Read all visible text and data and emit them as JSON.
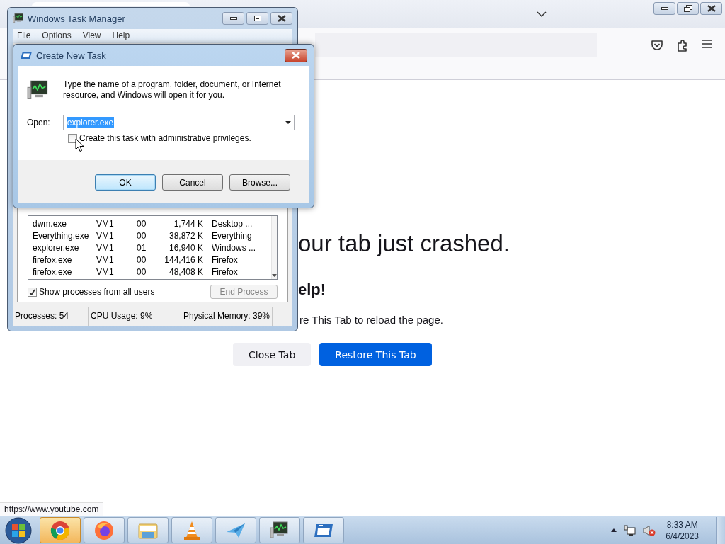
{
  "browser": {
    "status_link": "https://www.youtube.com",
    "crash_page": {
      "heading": "our tab just crashed.",
      "subheading": "elp!",
      "instruction": "re This Tab to reload the page.",
      "buttons": [
        {
          "label": "Close Tab",
          "kind": "secondary"
        },
        {
          "label": "Restore This Tab",
          "kind": "primary"
        }
      ]
    }
  },
  "task_manager": {
    "title": "Windows Task Manager",
    "menu": [
      "File",
      "Options",
      "View",
      "Help"
    ],
    "processes": {
      "rows": [
        [
          "dwm.exe",
          "VM1",
          "00",
          "1,744 K",
          "Desktop ..."
        ],
        [
          "Everything.exe",
          "VM1",
          "00",
          "38,872 K",
          "Everything"
        ],
        [
          "explorer.exe",
          "VM1",
          "01",
          "16,940 K",
          "Windows ..."
        ],
        [
          "firefox.exe",
          "VM1",
          "00",
          "144,416 K",
          "Firefox"
        ],
        [
          "firefox.exe",
          "VM1",
          "00",
          "48,408 K",
          "Firefox"
        ]
      ]
    },
    "show_all_users": {
      "label": "Show processes from all users",
      "checked": true
    },
    "end_process": {
      "label": "End Process",
      "disabled": true
    },
    "status_bar": [
      "Processes: 54",
      "CPU Usage: 9%",
      "Physical Memory: 39%"
    ]
  },
  "dialog": {
    "title": "Create New Task",
    "message": "Type the name of a program, folder, document, or Internet resource, and Windows will open it for you.",
    "open_label": "Open:",
    "open_value": "explorer.exe",
    "value_selected": true,
    "admin_checkbox": {
      "label": "Create this task with administrative privileges.",
      "checked": false
    },
    "buttons": [
      {
        "label": "OK",
        "default": true
      },
      {
        "label": "Cancel",
        "default": false
      },
      {
        "label": "Browse...",
        "default": false
      }
    ]
  },
  "taskbar": {
    "items": [
      {
        "kind": "chrome",
        "selected": true
      },
      {
        "kind": "firefox",
        "selected": false
      },
      {
        "kind": "folder",
        "selected": false
      },
      {
        "kind": "cone",
        "selected": false
      },
      {
        "kind": "plane",
        "selected": false
      },
      {
        "kind": "monitor",
        "selected": false
      },
      {
        "kind": "window",
        "selected": false
      }
    ],
    "clock": {
      "time": "8:33 AM",
      "date": "6/4/2023"
    }
  }
}
